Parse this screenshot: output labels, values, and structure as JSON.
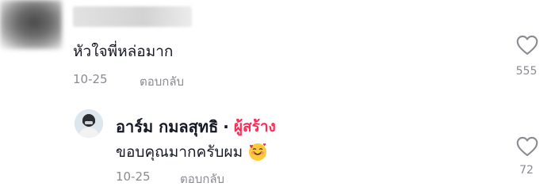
{
  "comments": [
    {
      "text": "หัวใจพี่หล่อมาก",
      "date": "10-25",
      "reply_label": "ตอบกลับ",
      "likes": "555",
      "blurred": true
    },
    {
      "username": "อาร์ม กมลสุทธิ",
      "separator": "·",
      "creator_tag": "ผู้สร้าง",
      "text": "ขอบคุณมากครับผม",
      "emoji": "smiling-face-with-hearts-icon",
      "date": "10-25",
      "reply_label": "ตอบกลับ",
      "likes": "72"
    }
  ],
  "colors": {
    "text": "#161823",
    "muted": "#8a8b91",
    "creator": "#fe2c55"
  }
}
